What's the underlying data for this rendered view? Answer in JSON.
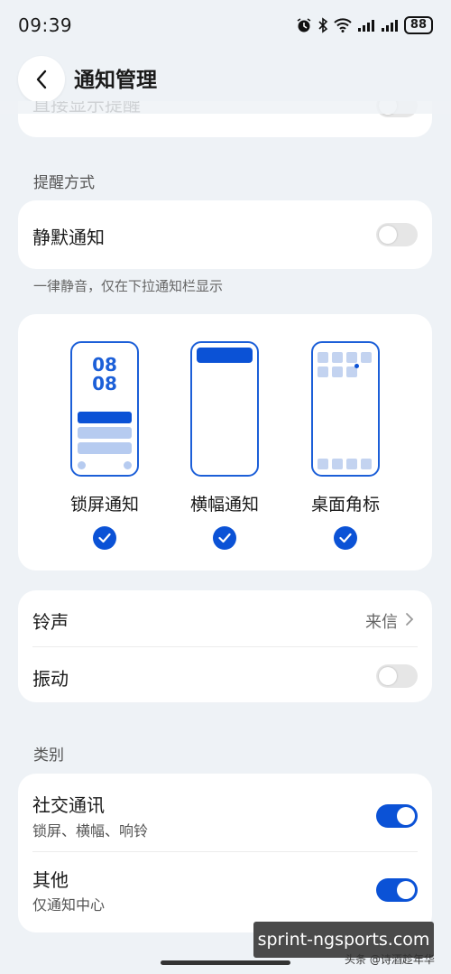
{
  "status_bar": {
    "time": "09:39",
    "battery": "88"
  },
  "header": {
    "title": "通知管理"
  },
  "top_card": {
    "partial_label": "直接显示提醒"
  },
  "reminder_section": {
    "label": "提醒方式",
    "silent": {
      "label": "静默通知",
      "enabled": false
    },
    "silent_desc": "一律静音，仅在下拉通知栏显示"
  },
  "display_modes": {
    "lock_screen": {
      "label": "锁屏通知",
      "preview_time_line1": "08",
      "preview_time_line2": "08",
      "checked": true
    },
    "banner": {
      "label": "横幅通知",
      "checked": true
    },
    "badge": {
      "label": "桌面角标",
      "checked": true
    }
  },
  "sound_card": {
    "ringtone": {
      "label": "铃声",
      "value": "来信"
    },
    "vibrate": {
      "label": "振动",
      "enabled": false
    }
  },
  "category_section": {
    "label": "类别",
    "items": [
      {
        "label": "社交通讯",
        "sub": "锁屏、横幅、响铃",
        "enabled": true
      },
      {
        "label": "其他",
        "sub": "仅通知中心",
        "enabled": true
      }
    ]
  },
  "watermark": {
    "text": "sprint-ngsports.com",
    "credit": "头条 @诗酒趁年华"
  },
  "colors": {
    "accent": "#0b52d6",
    "background": "#eef2f6",
    "card": "#ffffff"
  }
}
